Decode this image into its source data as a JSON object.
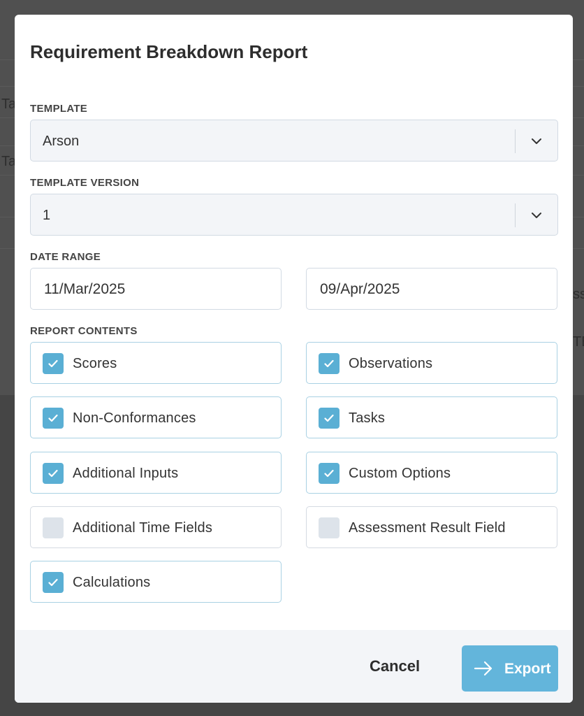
{
  "background": {
    "fragments": [
      "Ta",
      "Ta",
      "ss",
      "TE"
    ]
  },
  "dialog": {
    "title": "Requirement Breakdown Report",
    "template": {
      "label": "TEMPLATE",
      "value": "Arson"
    },
    "template_version": {
      "label": "TEMPLATE VERSION",
      "value": "1"
    },
    "date_range": {
      "label": "DATE RANGE",
      "start": "11/Mar/2025",
      "end": "09/Apr/2025"
    },
    "report_contents": {
      "label": "REPORT CONTENTS",
      "options": [
        {
          "label": "Scores",
          "checked": true
        },
        {
          "label": "Observations",
          "checked": true
        },
        {
          "label": "Non-Conformances",
          "checked": true
        },
        {
          "label": "Tasks",
          "checked": true
        },
        {
          "label": "Additional Inputs",
          "checked": true
        },
        {
          "label": "Custom Options",
          "checked": true
        },
        {
          "label": "Additional Time Fields",
          "checked": false
        },
        {
          "label": "Assessment Result Field",
          "checked": false
        },
        {
          "label": "Calculations",
          "checked": true
        }
      ]
    },
    "footer": {
      "cancel_label": "Cancel",
      "export_label": "Export"
    }
  },
  "colors": {
    "accent": "#5aafd4",
    "export_button": "#63b5db",
    "unchecked_box": "#dde3ea"
  },
  "icons": {
    "select_chevron": "chevron-down-icon",
    "checkbox_mark": "check-icon",
    "export": "arrow-right-icon"
  }
}
